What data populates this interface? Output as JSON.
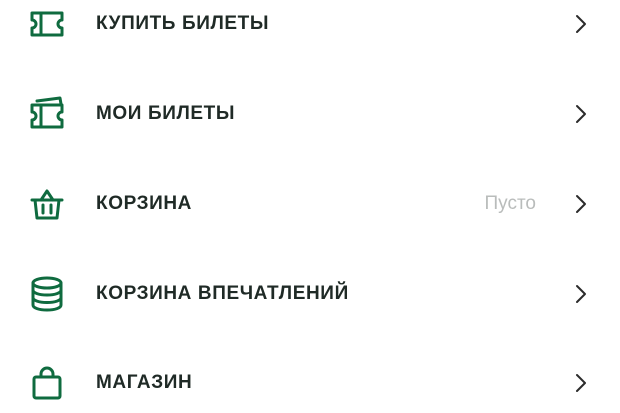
{
  "menu": {
    "items": [
      {
        "label": "КУПИТЬ БИЛЕТЫ",
        "icon": "ticket-icon",
        "value": ""
      },
      {
        "label": "МОИ БИЛЕТЫ",
        "icon": "tickets-stack-icon",
        "value": ""
      },
      {
        "label": "КОРЗИНА",
        "icon": "basket-icon",
        "value": "Пусто"
      },
      {
        "label": "КОРЗИНА ВПЕЧАТЛЕНИЙ",
        "icon": "coins-stack-icon",
        "value": ""
      },
      {
        "label": "МАГАЗИН",
        "icon": "shopping-bag-icon",
        "value": ""
      }
    ]
  },
  "colors": {
    "accent": "#0f6b3f",
    "label": "#1f2a26",
    "muted": "#b9bcbb",
    "chevron": "#2b2b2b",
    "background": "#ffffff"
  }
}
